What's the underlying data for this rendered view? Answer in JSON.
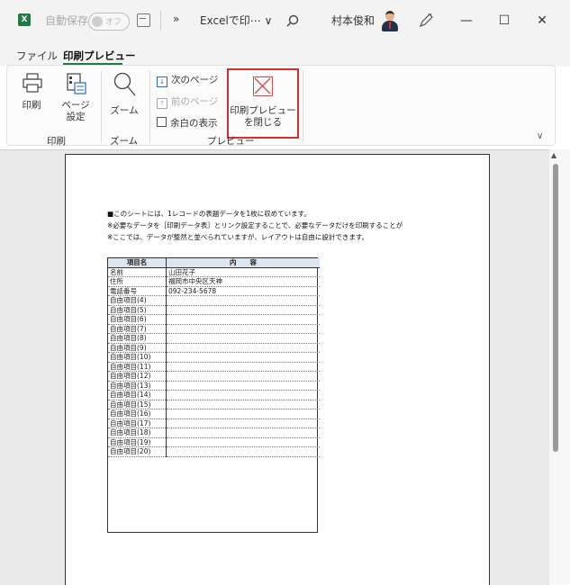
{
  "titlebar": {
    "autosave_label": "自動保存",
    "autosave_state": "オフ",
    "more_label": "»",
    "doc_title": "Excelで印⋯ ∨",
    "user_name": "村本俊和",
    "minimize": "—",
    "maximize": "☐",
    "close": "✕"
  },
  "menu": {
    "tabs": [
      {
        "label": "ファイル"
      },
      {
        "label": "印刷プレビュー"
      }
    ]
  },
  "ribbon": {
    "print_label": "印刷",
    "page_setup_label_1": "ページ",
    "page_setup_label_2": "設定",
    "zoom_label": "ズーム",
    "next_page_label": "次のページ",
    "prev_page_label": "前のページ",
    "margins_label": "余白の表示",
    "close_preview_label_1": "印刷プレビュー",
    "close_preview_label_2": "を閉じる",
    "groups": {
      "print": "印刷",
      "zoom": "ズーム",
      "preview": "プレビュー"
    }
  },
  "preview": {
    "notes": [
      "■このシートには、1レコードの表題データを1枚に収めています。",
      "※必要なデータを［印刷データ表］とリンク設定することで、必要なデータだけを印刷することが",
      "※ここでは、データが整然と並べられていますが、レイアウトは自由に設計できます。"
    ],
    "table": {
      "headers": [
        "項目名",
        "内　　容"
      ],
      "rows": [
        [
          "名前",
          "山田花子"
        ],
        [
          "住所",
          "福岡市中央区天神"
        ],
        [
          "電話番号",
          "092-234-5678"
        ],
        [
          "自由項目(4)",
          ""
        ],
        [
          "自由項目(5)",
          ""
        ],
        [
          "自由項目(6)",
          ""
        ],
        [
          "自由項目(7)",
          ""
        ],
        [
          "自由項目(8)",
          ""
        ],
        [
          "自由項目(9)",
          ""
        ],
        [
          "自由項目(10)",
          ""
        ],
        [
          "自由項目(11)",
          ""
        ],
        [
          "自由項目(12)",
          ""
        ],
        [
          "自由項目(13)",
          ""
        ],
        [
          "自由項目(14)",
          ""
        ],
        [
          "自由項目(15)",
          ""
        ],
        [
          "自由項目(16)",
          ""
        ],
        [
          "自由項目(17)",
          ""
        ],
        [
          "自由項目(18)",
          ""
        ],
        [
          "自由項目(19)",
          ""
        ],
        [
          "自由項目(20)",
          ""
        ]
      ]
    }
  },
  "colors": {
    "excel_green": "#1f7a45",
    "highlight_red": "#d32f2f",
    "header_fill": "#dce6f1"
  }
}
